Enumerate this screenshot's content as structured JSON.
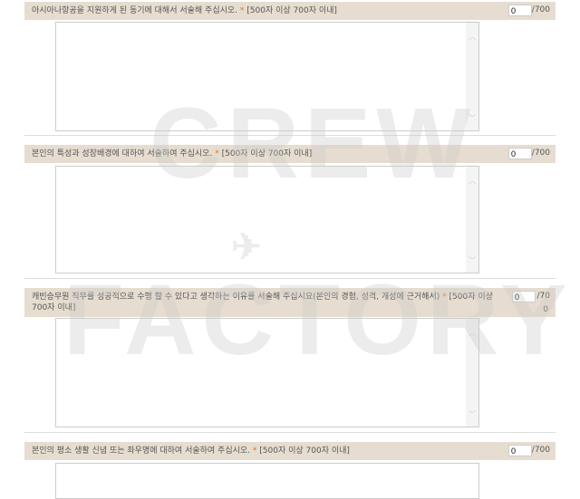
{
  "questions": [
    {
      "label": "아시아나항공을 지원하게 된 동기에 대해서 서술해 주십시오.",
      "required": "*",
      "limit": "[500자 이상 700자 이내]",
      "count": "0",
      "max": "/700"
    },
    {
      "label": "본인의 특성과 성장배경에 대하여 서술하여 주십시오.",
      "required": "*",
      "limit": "[500자 이상 700자 이내]",
      "count": "0",
      "max": "/700"
    },
    {
      "label": "캐빈승무원 직무를 성공적으로 수행 할 수 있다고 생각하는 이유를 서술해 주십시요(본인의 경험, 성격, 개성에 근거해서)",
      "required": "*",
      "limit": "[500자 이상 700자 이내]",
      "count": "0",
      "max": "/70",
      "max_wrap": "0"
    },
    {
      "label": "본인의 평소 생활 신념 또는 좌우명에 대하여 서술하여 주십시오.",
      "required": "*",
      "limit": "[500자 이상 700자 이내]",
      "count": "0",
      "max": "/700"
    }
  ],
  "watermark": {
    "line1": "CREW",
    "line2": "FACTORY"
  }
}
